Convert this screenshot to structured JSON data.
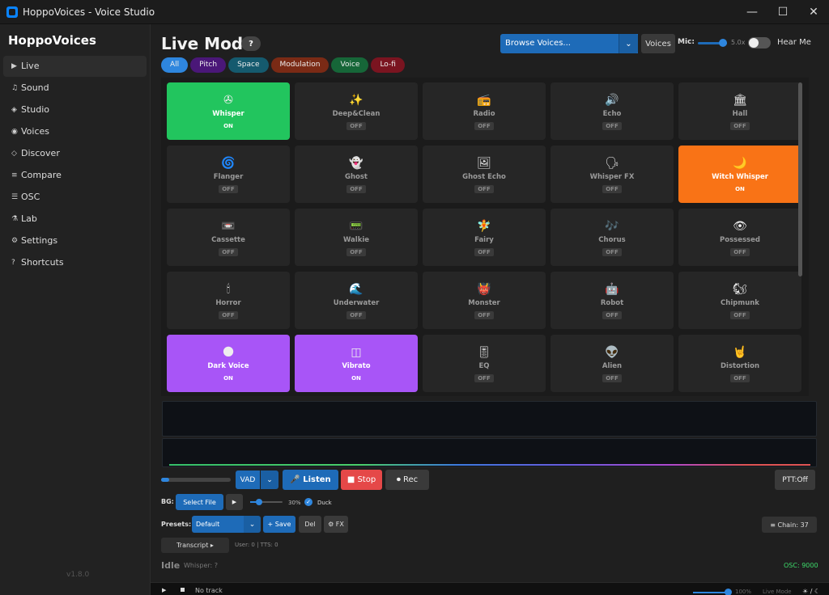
{
  "window": {
    "title": "HoppoVoices - Voice Studio",
    "controls": {
      "minimize": "—",
      "maximize": "☐",
      "close": "✕"
    }
  },
  "sidebar": {
    "brand": "HoppoVoices",
    "items": [
      {
        "glyph": "▶",
        "label": "Live",
        "active": true
      },
      {
        "glyph": "♫",
        "label": "Sound"
      },
      {
        "glyph": "◈",
        "label": "Studio"
      },
      {
        "glyph": "◉",
        "label": "Voices"
      },
      {
        "glyph": "◇",
        "label": "Discover"
      },
      {
        "glyph": "≡",
        "label": "Compare"
      },
      {
        "glyph": "☰",
        "label": "OSC"
      },
      {
        "glyph": "⚗",
        "label": "Lab"
      },
      {
        "glyph": "⚙",
        "label": "Settings"
      },
      {
        "glyph": "?",
        "label": "Shortcuts"
      }
    ],
    "version": "v1.8.0"
  },
  "header": {
    "title": "Live Mode",
    "help": "?",
    "browse_placeholder": "Browse Voices...",
    "voices_button": "Voices",
    "mic_label": "Mic:",
    "mic_value": "5.0x",
    "hear_me_label": "Hear Me"
  },
  "filters": [
    {
      "label": "All",
      "bg": "#2e86de"
    },
    {
      "label": "Pitch",
      "bg": "#4a1778"
    },
    {
      "label": "Space",
      "bg": "#155a6e"
    },
    {
      "label": "Modulation",
      "bg": "#7a2a15"
    },
    {
      "label": "Voice",
      "bg": "#166638"
    },
    {
      "label": "Lo-fi",
      "bg": "#7a1420"
    }
  ],
  "effects": [
    {
      "name": "Whisper",
      "icon": "✇",
      "state": "ON",
      "color": "#22c55e"
    },
    {
      "name": "Deep&Clean",
      "icon": "✨",
      "state": "OFF"
    },
    {
      "name": "Radio",
      "icon": "📻",
      "state": "OFF"
    },
    {
      "name": "Echo",
      "icon": "🔊",
      "state": "OFF"
    },
    {
      "name": "Hall",
      "icon": "🏛",
      "state": "OFF"
    },
    {
      "name": "Flanger",
      "icon": "🌀",
      "state": "OFF"
    },
    {
      "name": "Ghost",
      "icon": "👻",
      "state": "OFF"
    },
    {
      "name": "Ghost Echo",
      "icon": "🖼",
      "state": "OFF"
    },
    {
      "name": "Whisper FX",
      "icon": "🗣",
      "state": "OFF"
    },
    {
      "name": "Witch Whisper",
      "icon": "🌙",
      "state": "ON",
      "color": "#f97316"
    },
    {
      "name": "Cassette",
      "icon": "📼",
      "state": "OFF"
    },
    {
      "name": "Walkie",
      "icon": "📟",
      "state": "OFF"
    },
    {
      "name": "Fairy",
      "icon": "🧚",
      "state": "OFF"
    },
    {
      "name": "Chorus",
      "icon": "🎶",
      "state": "OFF"
    },
    {
      "name": "Possessed",
      "icon": "👁",
      "state": "OFF"
    },
    {
      "name": "Horror",
      "icon": "🕯",
      "state": "OFF"
    },
    {
      "name": "Underwater",
      "icon": "🌊",
      "state": "OFF"
    },
    {
      "name": "Monster",
      "icon": "👹",
      "state": "OFF"
    },
    {
      "name": "Robot",
      "icon": "🤖",
      "state": "OFF"
    },
    {
      "name": "Chipmunk",
      "icon": "🐿",
      "state": "OFF"
    },
    {
      "name": "Dark Voice",
      "icon": "🌑",
      "state": "ON",
      "color": "#a855f7"
    },
    {
      "name": "Vibrato",
      "icon": "◫",
      "state": "ON",
      "color": "#a855f7"
    },
    {
      "name": "EQ",
      "icon": "🎚",
      "state": "OFF"
    },
    {
      "name": "Alien",
      "icon": "👽",
      "state": "OFF"
    },
    {
      "name": "Distortion",
      "icon": "🤘",
      "state": "OFF"
    }
  ],
  "controls": {
    "vad": "VAD",
    "listen": "🎤 Listen",
    "stop": "■ Stop",
    "rec": "⏺ Rec",
    "ptt": "PTT:Off",
    "caret": "⌄"
  },
  "bg": {
    "label": "BG:",
    "select_file": "Select File",
    "play": "▶",
    "value": "30%",
    "duck": "Duck",
    "duck_checked": "✓"
  },
  "presets": {
    "label": "Presets:",
    "selected": "Default",
    "save": "+ Save",
    "del": "Del",
    "fx": "⚙ FX",
    "chain": "≡ Chain: 37"
  },
  "transcript": {
    "button": "Transcript ▸",
    "counts": "User: 0 | TTS: 0"
  },
  "status": {
    "state": "Idle",
    "detail": "Whisper: ?",
    "osc": "OSC: 9000"
  },
  "bottom": {
    "play": "▶",
    "track": "No track",
    "volume": "100%",
    "mode": "Live Mode",
    "misc": "☀ / ☾"
  }
}
